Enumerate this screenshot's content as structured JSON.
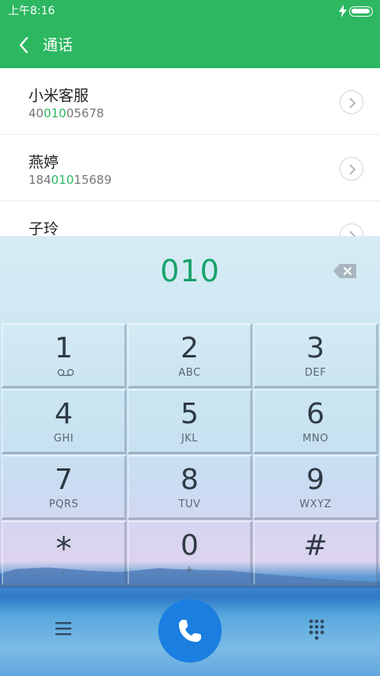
{
  "status": {
    "time": "上午8:16"
  },
  "appbar": {
    "title": "通话"
  },
  "contacts": [
    {
      "name": "小米客服",
      "num_pre": "40",
      "num_hl": "010",
      "num_post": "05678"
    },
    {
      "name": "燕婷",
      "num_pre": "184",
      "num_hl": "010",
      "num_post": "15689"
    },
    {
      "name": "子玲",
      "num_pre": "",
      "num_hl": "",
      "num_post": ""
    }
  ],
  "dialer": {
    "input": "010",
    "keys": [
      {
        "digit": "1",
        "letters": ""
      },
      {
        "digit": "2",
        "letters": "ABC"
      },
      {
        "digit": "3",
        "letters": "DEF"
      },
      {
        "digit": "4",
        "letters": "GHI"
      },
      {
        "digit": "5",
        "letters": "JKL"
      },
      {
        "digit": "6",
        "letters": "MNO"
      },
      {
        "digit": "7",
        "letters": "PQRS"
      },
      {
        "digit": "8",
        "letters": "TUV"
      },
      {
        "digit": "9",
        "letters": "WXYZ"
      },
      {
        "digit": "*",
        "letters": ","
      },
      {
        "digit": "0",
        "letters": "+"
      },
      {
        "digit": "#",
        "letters": ""
      }
    ]
  },
  "colors": {
    "accent": "#2cb760",
    "call": "#1a7fe0",
    "digits": "#1aa36c"
  },
  "icons": {
    "back": "chevron-left-icon",
    "charging": "lightning-bolt-icon",
    "battery": "battery-icon",
    "row_arrow": "chevron-right-icon",
    "delete": "backspace-icon",
    "voicemail": "voicemail-icon",
    "menu": "menu-icon",
    "call": "phone-icon",
    "dialpad": "dialpad-icon"
  }
}
